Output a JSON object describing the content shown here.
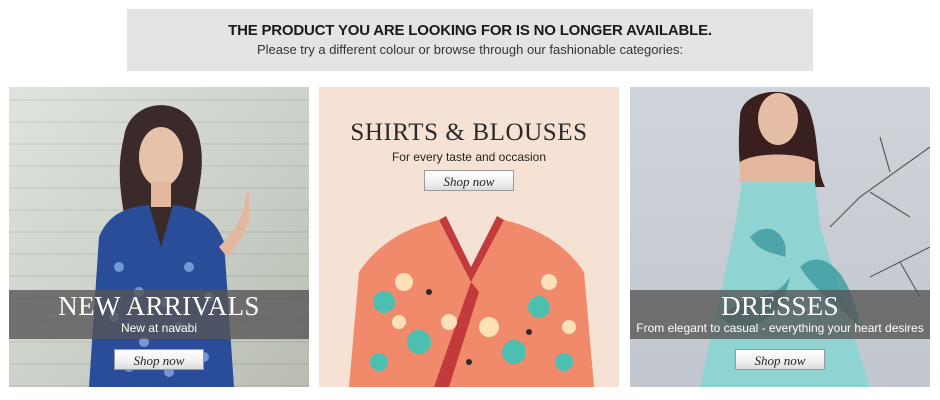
{
  "notice": {
    "headline": "THE PRODUCT YOU ARE LOOKING FOR IS NO LONGER AVAILABLE.",
    "subtext": "Please try a different colour or browse through our fashionable categories:"
  },
  "categories": [
    {
      "title": "NEW ARRIVALS",
      "tagline": "New at navabi",
      "button": "Shop now"
    },
    {
      "title": "SHIRTS & BLOUSES",
      "tagline": "For every taste and occasion",
      "button": "Shop now"
    },
    {
      "title": "DRESSES",
      "tagline": "From elegant to casual - everything your heart desires",
      "button": "Shop now"
    }
  ],
  "colors": {
    "notice_bg": "#e4e4e4",
    "overlay": "#555555",
    "shirts_bg": "#f6e2d4"
  }
}
